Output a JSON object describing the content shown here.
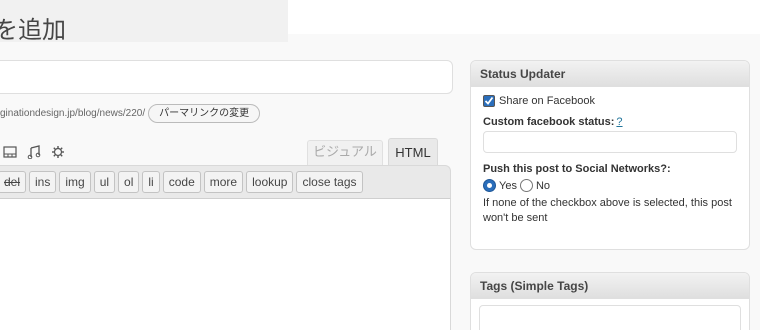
{
  "page": {
    "title": "を追加"
  },
  "permalink": {
    "url": "ginationdesign.jp/blog/news/220/",
    "change_button": "パーマリンクの変更"
  },
  "editor": {
    "tabs": {
      "visual": "ビジュアル",
      "html": "HTML"
    },
    "media_icons": [
      "image-icon",
      "music-icon",
      "gear-icon"
    ],
    "quicktags": [
      "del",
      "ins",
      "img",
      "ul",
      "ol",
      "li",
      "code",
      "more",
      "lookup",
      "close tags"
    ]
  },
  "status_updater": {
    "title": "Status Updater",
    "share_facebook_label": "Share on Facebook",
    "share_facebook_checked": true,
    "custom_status_label": "Custom facebook status",
    "custom_status_colon": ":",
    "help_link": "?",
    "push_label": "Push this post to Social Networks?:",
    "yes_label": "Yes",
    "no_label": "No",
    "selected": "Yes",
    "note": "If none of the checkbox above is selected, this post won't be sent"
  },
  "tags_box": {
    "title": "Tags (Simple Tags)"
  }
}
